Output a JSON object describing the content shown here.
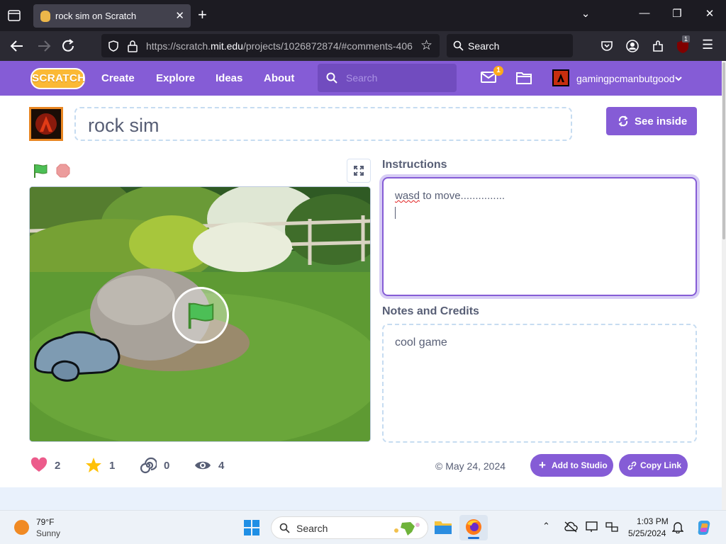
{
  "browser": {
    "tab_title": "rock sim on Scratch",
    "url_prefix": "https://scratch.",
    "url_domain": "mit.edu",
    "url_path": "/projects/1026872874/#comments-406",
    "search_placeholder": "Search",
    "extension_badge": "1"
  },
  "scratch_nav": {
    "logo_text": "SCRATCH",
    "menu": [
      "Create",
      "Explore",
      "Ideas",
      "About"
    ],
    "search_placeholder": "Search",
    "messages_count": "1",
    "username": "gamingpcmanbutgood"
  },
  "project": {
    "title": "rock sim",
    "see_inside_label": "See inside",
    "instructions_heading": "Instructions",
    "instructions_text_misspelled": "wasd",
    "instructions_text_rest": " to move...............",
    "notes_heading": "Notes and Credits",
    "notes_text": "cool game",
    "stats": {
      "loves": "2",
      "favorites": "1",
      "remixes": "0",
      "views": "4"
    },
    "date": "© May 24, 2024",
    "add_to_studio_label": "Add to Studio",
    "copy_link_label": "Copy Link"
  },
  "taskbar": {
    "weather_temp": "79°F",
    "weather_condition": "Sunny",
    "search_placeholder": "Search",
    "time": "1:03 PM",
    "date": "5/25/2024"
  },
  "colors": {
    "scratch_purple": "#855cd6",
    "browser_dark": "#1c1b22",
    "text_gray": "#575e75"
  }
}
